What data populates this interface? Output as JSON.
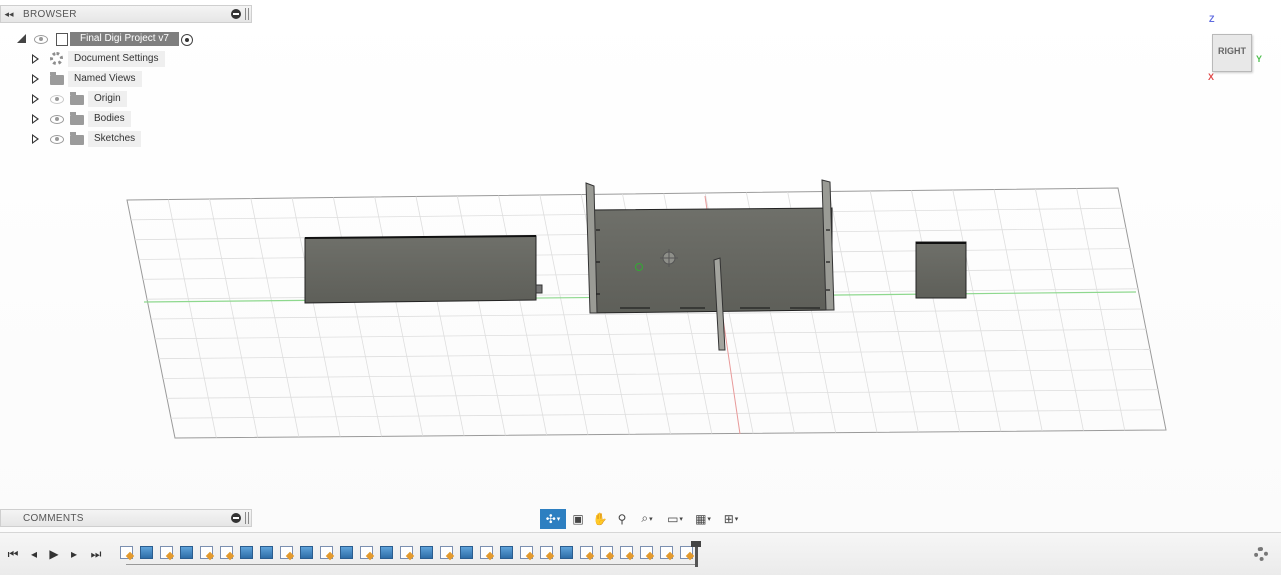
{
  "browser": {
    "title": "BROWSER",
    "root": {
      "label": "Final Digi Project v7"
    },
    "items": [
      {
        "label": "Document Settings",
        "icon": "gear-icon"
      },
      {
        "label": "Named Views",
        "icon": "folder-icon"
      },
      {
        "label": "Origin",
        "icon": "folder-icon",
        "visibility": "hidden"
      },
      {
        "label": "Bodies",
        "icon": "folder-icon"
      },
      {
        "label": "Sketches",
        "icon": "folder-icon"
      }
    ]
  },
  "comments": {
    "title": "COMMENTS"
  },
  "viewcube": {
    "face": "RIGHT",
    "z": "Z",
    "x": "X",
    "y": "Y"
  },
  "navbar": {
    "tools": [
      "orbit-icon",
      "look-at-icon",
      "pan-icon",
      "zoom-icon",
      "fit-icon",
      "display-settings-icon",
      "grid-icon",
      "viewports-icon"
    ]
  },
  "timeline": {
    "controls": [
      "go-to-start",
      "step-back",
      "play",
      "step-forward",
      "go-to-end"
    ],
    "features": [
      "sketch",
      "extrude",
      "sketch",
      "extrude",
      "sketch",
      "sketch",
      "extrude",
      "extrude",
      "sketch",
      "extrude",
      "sketch",
      "extrude",
      "sketch",
      "extrude",
      "sketch",
      "extrude",
      "sketch",
      "extrude",
      "sketch",
      "extrude",
      "sketch",
      "sketch",
      "extrude",
      "sketch",
      "sketch",
      "sketch",
      "sketch",
      "sketch",
      "sketch"
    ]
  },
  "colors": {
    "accent": "#2d7fc1",
    "body": "#6c6c66",
    "axis_x": "#e06a6a",
    "axis_y": "#7ccf7c"
  }
}
